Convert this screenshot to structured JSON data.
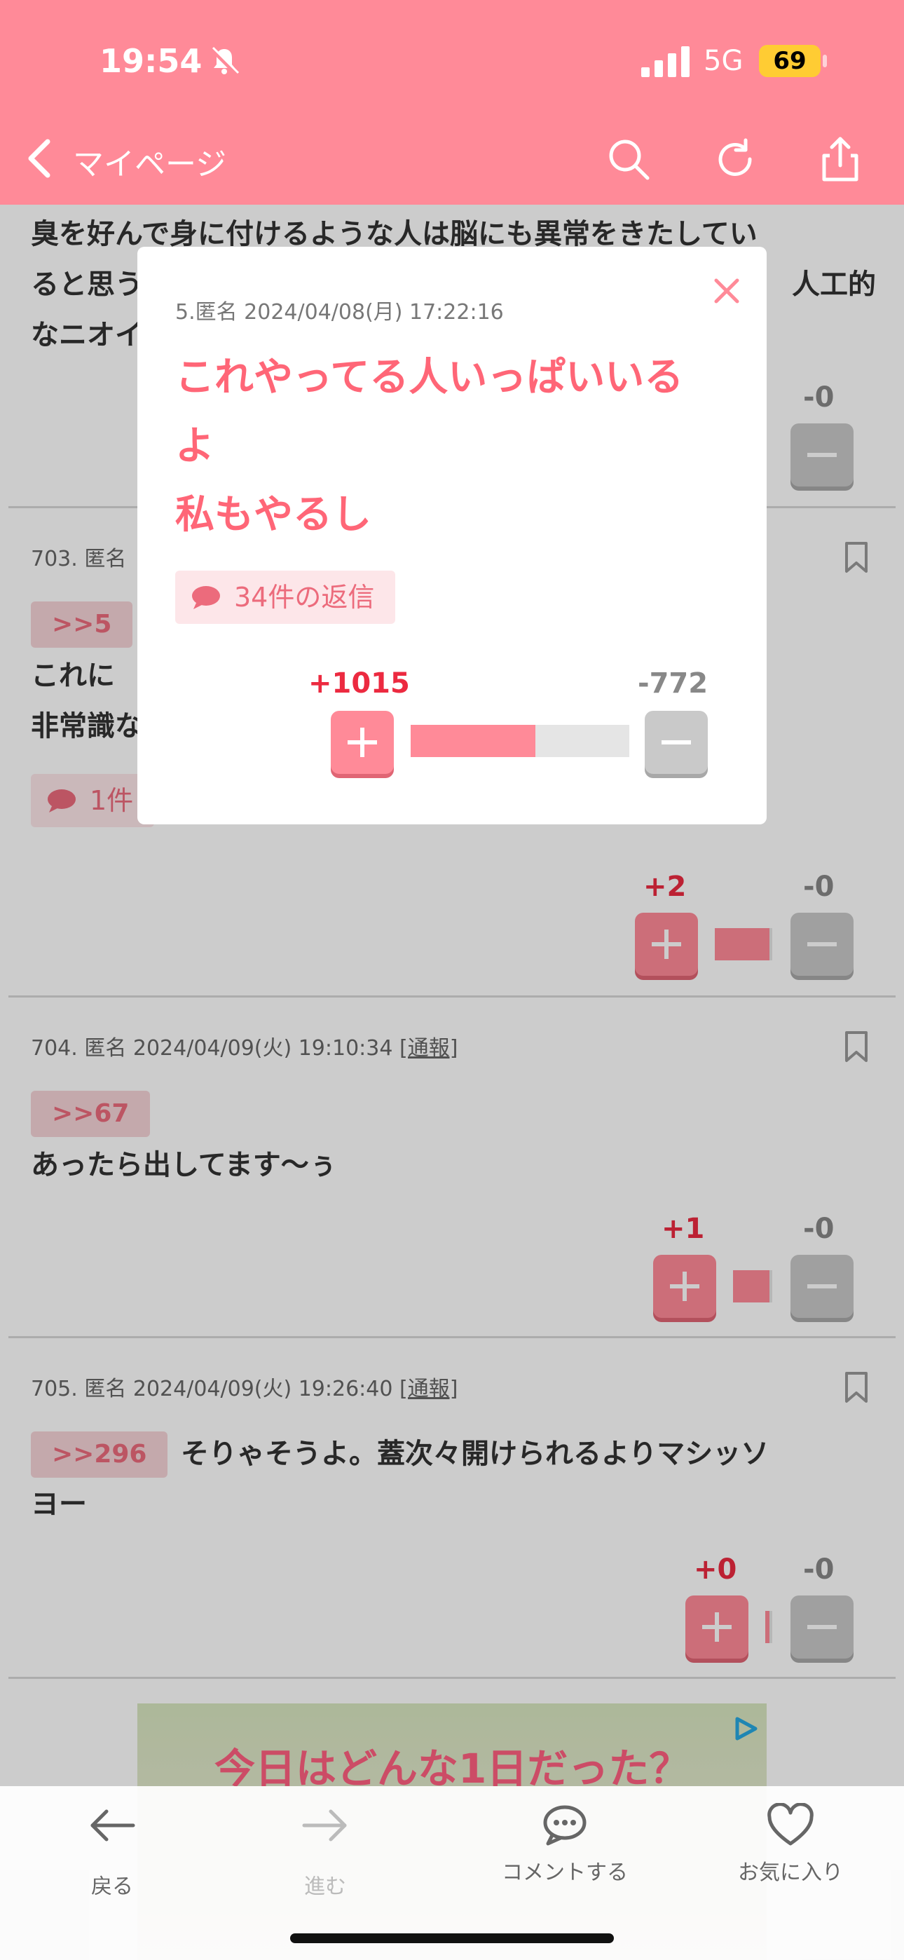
{
  "status": {
    "time": "19:54",
    "network": "5G",
    "battery": "69"
  },
  "header": {
    "back_label": "マイページ"
  },
  "posts": {
    "top_text_lines": [
      "臭を好んで身に付けるような人は脳にも異常をきたしてい",
      "ると思う",
      "人工的",
      "なニオイ"
    ],
    "top_minus": "-0",
    "p703": {
      "meta": "703. 匿名",
      "ref": ">>5",
      "lines": [
        "これに",
        "非常識な"
      ],
      "reply": "1件",
      "plus": "+2",
      "minus": "-0"
    },
    "p704": {
      "meta": "704. 匿名 2024/04/09(火) 19:10:34 ",
      "report": "[通報]",
      "ref": ">>67",
      "text": "あったら出してます〜ぅ",
      "plus": "+1",
      "minus": "-0"
    },
    "p705": {
      "meta": "705. 匿名 2024/04/09(火) 19:26:40 ",
      "report": "[通報]",
      "ref": ">>296",
      "text_line1": "そりゃそうよ。蓋次々開けられるよりマシッソ",
      "text_line2": "ヨー",
      "plus": "+0",
      "minus": "-0"
    }
  },
  "modal": {
    "meta": "5.匿名 2024/04/08(月) 17:22:16",
    "lines": [
      "これやってる人いっぱいいる",
      "よ",
      "私もやるし"
    ],
    "reply": "34件の返信",
    "plus": "+1015",
    "minus": "-772",
    "plus_share": 0.57
  },
  "ad": {
    "title": "今日はどんな1日だった？"
  },
  "toolbar": {
    "back": "戻る",
    "forward": "進む",
    "comment": "コメントする",
    "favorite": "お気に入り"
  },
  "colors": {
    "brand": "#ff8a98",
    "plus": "#ec2a40",
    "minus": "#888888"
  }
}
